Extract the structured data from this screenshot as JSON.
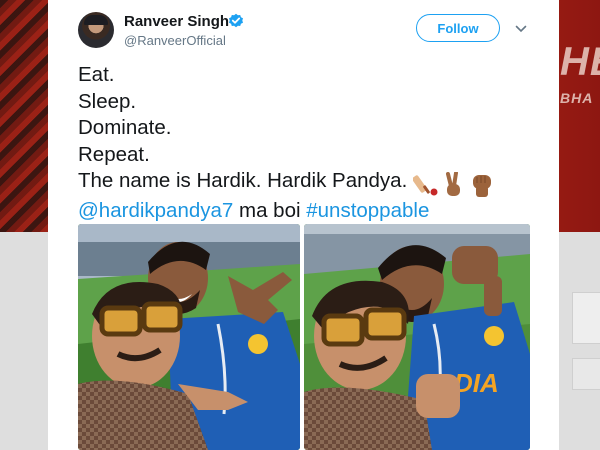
{
  "tweet": {
    "author": {
      "display_name": "Ranveer Singh",
      "handle": "@RanveerOfficial",
      "verified": true
    },
    "follow_label": "Follow",
    "lines": [
      "Eat.",
      "Sleep.",
      "Dominate.",
      "Repeat.",
      "The name is Hardik. Hardik Pandya."
    ],
    "emoji_icons": [
      "cricket-bat-icon",
      "victory-hand-icon",
      "raised-fist-icon"
    ],
    "mention": "@hardikpandya7",
    "middle_text": " ma boi ",
    "hashtag": "#unstoppable",
    "media": [
      "photo-selfie-left",
      "photo-selfie-right"
    ]
  },
  "backdrop": {
    "right_text_large": "HE",
    "right_text_small": "BHA"
  },
  "colors": {
    "link": "#1b95e0",
    "follow": "#1da1f2",
    "text": "#14171a",
    "secondary": "#657786"
  }
}
